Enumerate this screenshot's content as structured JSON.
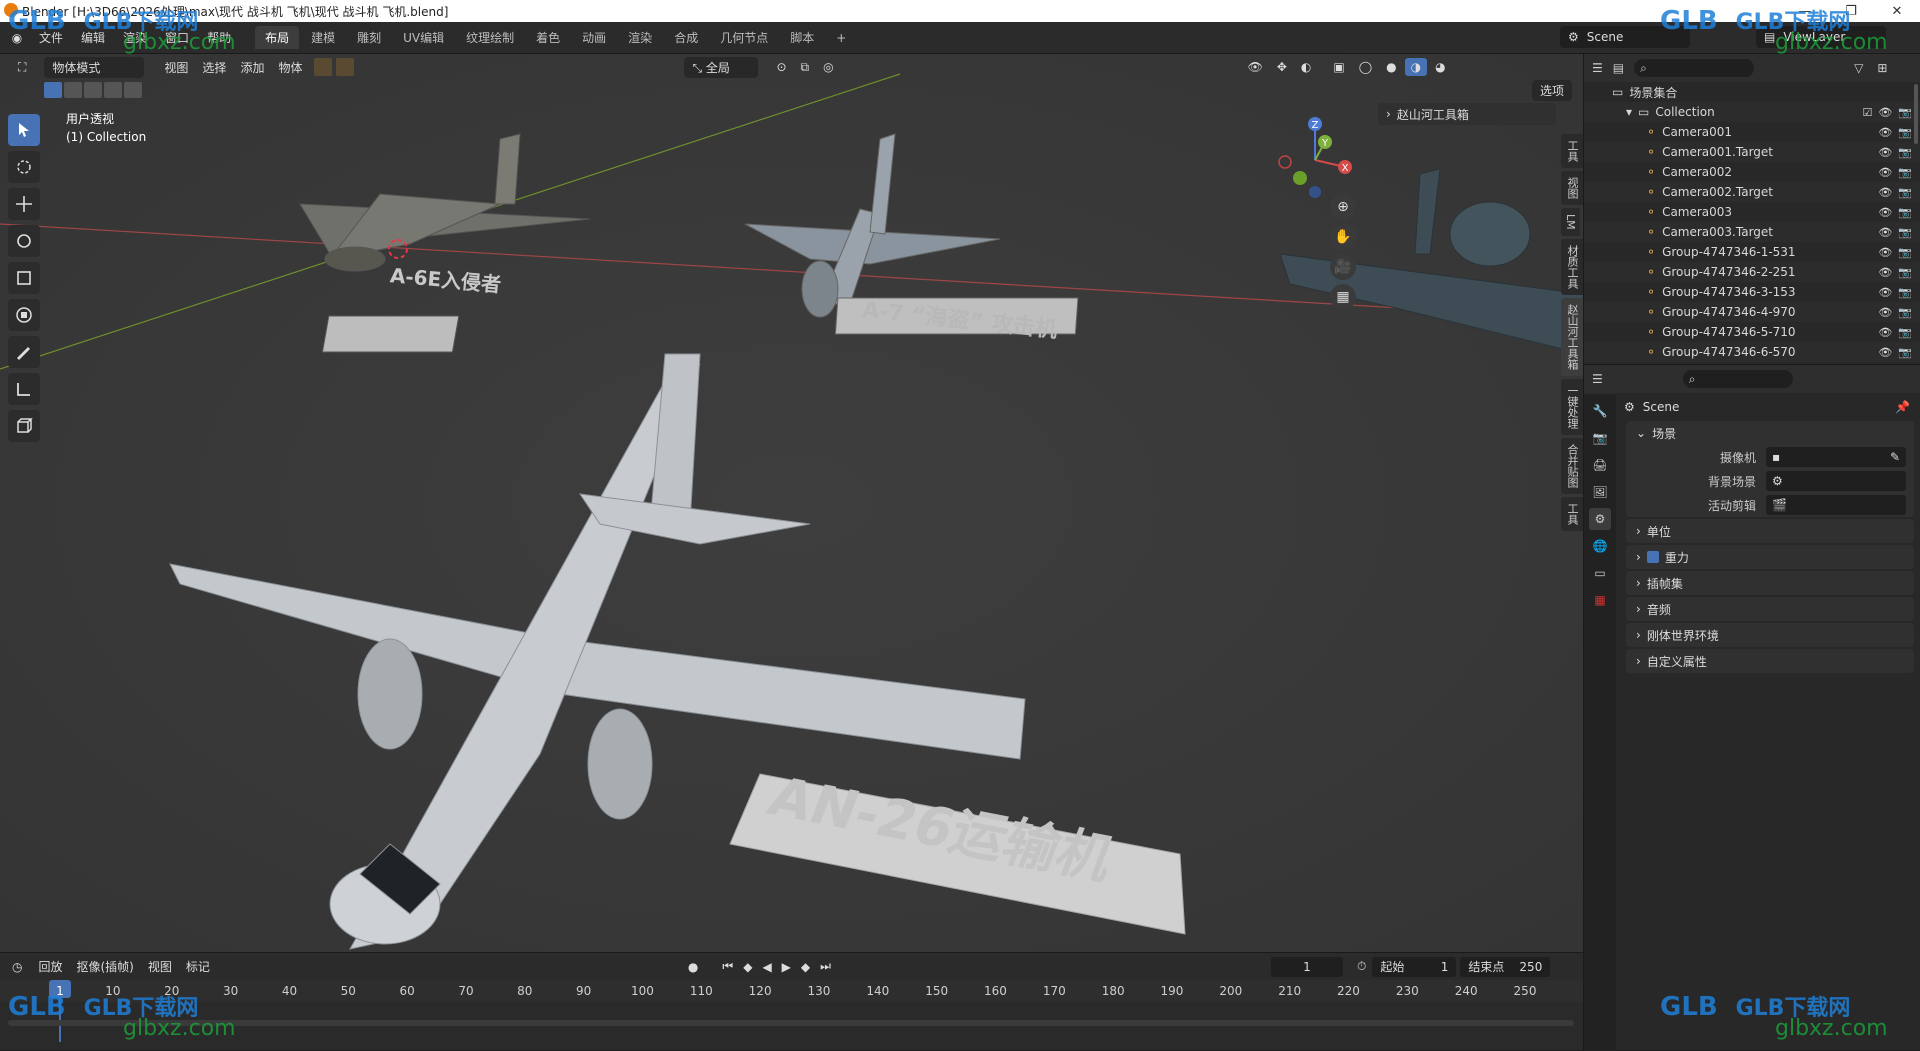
{
  "window": {
    "title": "Blender [H:\\3D66\\2026处理\\max\\现代 战斗机 飞机\\现代 战斗机 飞机.blend]",
    "minimize": "—",
    "maximize": "❐",
    "close": "✕"
  },
  "menu": [
    "文件",
    "编辑",
    "渲染",
    "窗口",
    "帮助"
  ],
  "workspaces": [
    "布局",
    "建模",
    "雕刻",
    "UV编辑",
    "纹理绘制",
    "着色",
    "动画",
    "渲染",
    "合成",
    "几何节点",
    "脚本"
  ],
  "active_workspace": "布局",
  "add_workspace": "+",
  "scene_name": "Scene",
  "view_layer": "ViewLayer",
  "viewport": {
    "mode": "物体模式",
    "menus": [
      "视图",
      "选择",
      "添加",
      "物体"
    ],
    "transform_orientation": "全局",
    "options": "选项",
    "view_name": "用户透视",
    "collection_info": "(1) Collection",
    "addon_panel": "赵山河工具箱",
    "npanel_tabs": [
      "工具",
      "视图",
      "LM",
      "材质工具",
      "赵山河工具箱",
      "一键处理",
      "合并贴图",
      "工具"
    ],
    "labels_3d": [
      "A-6E入侵者",
      "A-7 “海盗” 攻击机",
      "AN-26运输机"
    ]
  },
  "gizmo": {
    "x": "X",
    "y": "Y",
    "z": "Z"
  },
  "timeline": {
    "menus": [
      "回放",
      "抠像(插帧)",
      "视图",
      "标记"
    ],
    "current_frame": "1",
    "start_label": "起始",
    "start": "1",
    "end_label": "结束点",
    "end": "250",
    "ruler": [
      "1",
      "10",
      "20",
      "30",
      "40",
      "50",
      "60",
      "70",
      "80",
      "90",
      "100",
      "110",
      "120",
      "130",
      "140",
      "150",
      "160",
      "170",
      "180",
      "190",
      "200",
      "210",
      "220",
      "230",
      "240",
      "250"
    ]
  },
  "outliner": {
    "root": "场景集合",
    "collection": "Collection",
    "items": [
      "Camera001",
      "Camera001.Target",
      "Camera002",
      "Camera002.Target",
      "Camera003",
      "Camera003.Target",
      "Group-4747346-1-531",
      "Group-4747346-2-251",
      "Group-4747346-3-153",
      "Group-4747346-4-970",
      "Group-4747346-5-710",
      "Group-4747346-6-570"
    ]
  },
  "properties": {
    "context": "Scene",
    "scene_panel": "场景",
    "camera_label": "摄像机",
    "background_label": "背景场景",
    "clip_label": "活动剪辑",
    "panels": [
      "单位",
      "重力",
      "插帧集",
      "音频",
      "刚体世界环境",
      "自定义属性"
    ]
  },
  "watermarks": {
    "brand": "GLB下载网",
    "url": "glbxz.com",
    "logo": "GLB"
  }
}
